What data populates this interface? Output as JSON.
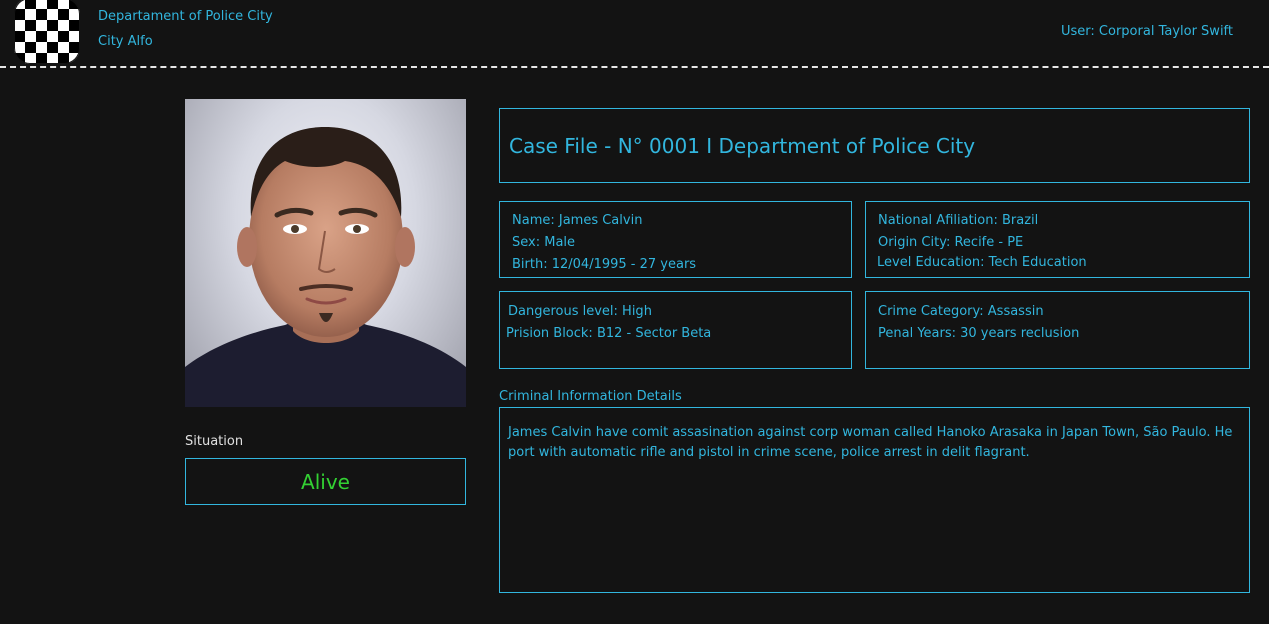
{
  "header": {
    "department": "Departament of Police City",
    "city": "City Alfo",
    "user": "User: Corporal Taylor Swift"
  },
  "profile": {
    "situation_label": "Situation",
    "situation_value": "Alive"
  },
  "case": {
    "title": "Case File - N° 0001  I Department of Police City",
    "personal": {
      "name": "Name: James Calvin",
      "sex": "Sex:  Male",
      "birth": "Birth:  12/04/1995 - 27 years"
    },
    "origin": {
      "national": "National Afiliation: Brazil",
      "origin_city": "Origin City: Recife - PE",
      "education": "Level Education: Tech Education"
    },
    "danger": {
      "level": "Dangerous level: High",
      "block": "Prision Block: B12 - Sector Beta"
    },
    "crime": {
      "category": "Crime Category: Assassin",
      "penal": "Penal Years: 30 years reclusion"
    },
    "details_label": "Criminal Information Details",
    "details_text": "James Calvin have comit assasination against corp woman called Hanoko Arasaka in Japan Town, São Paulo. He port with automatic rifle and pistol in crime scene, police arrest in delit flagrant."
  },
  "colors": {
    "background": "#131313",
    "accent": "#32b6de",
    "status_alive": "#33d133"
  },
  "icons": {
    "logo": "checkered-flag-icon"
  }
}
